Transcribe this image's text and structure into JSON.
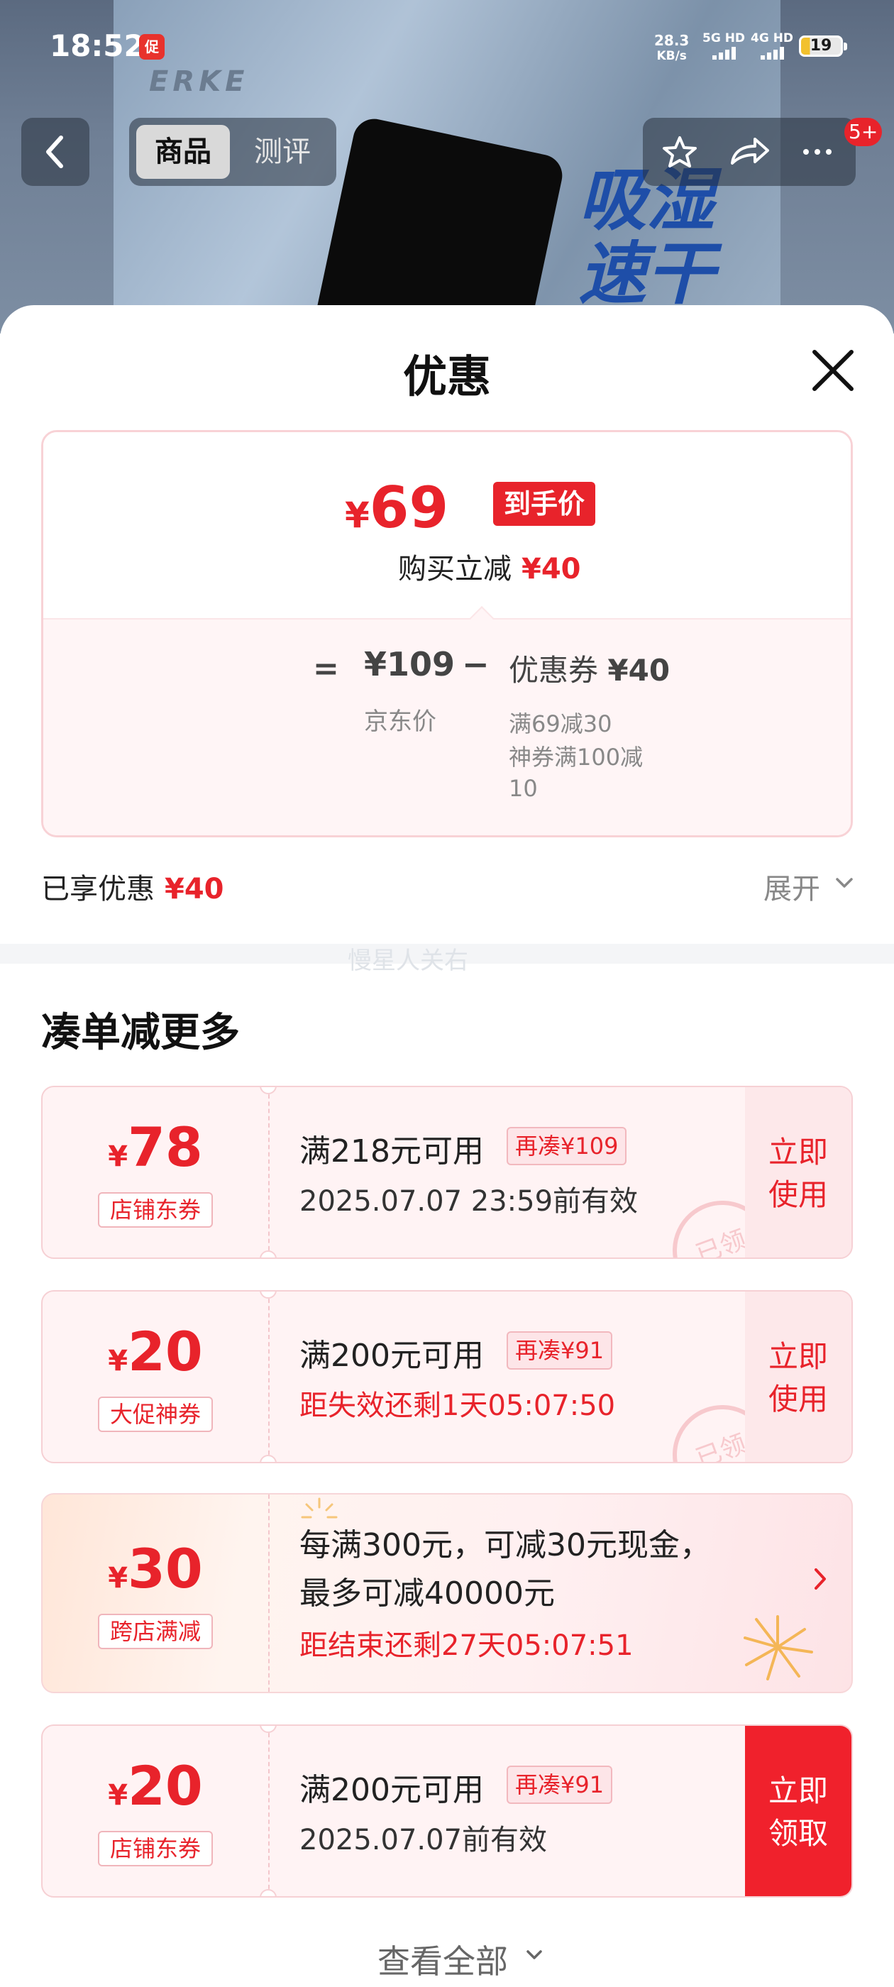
{
  "status_bar": {
    "time": "18:52",
    "network_speed_value": "28.3",
    "network_speed_unit": "KB/s",
    "signal_1": "5G HD",
    "signal_2": "4G HD",
    "battery": "19",
    "app_icon_label": "促"
  },
  "background": {
    "brand": "ERKE",
    "slogan_line1": "吸湿",
    "slogan_line2": "速干"
  },
  "nav": {
    "tabs": [
      "商品",
      "测评"
    ],
    "active_tab": "商品",
    "notification_badge": "5+"
  },
  "sheet": {
    "title": "优惠",
    "final_price_currency": "¥",
    "final_price_value": "69",
    "final_price_tag": "到手价",
    "instant_reduce_label": "购买立减",
    "instant_reduce_amount": "¥40",
    "equals": "=",
    "jd_price": "¥109",
    "jd_label": "京东价",
    "minus": "−",
    "coupon_label": "优惠券",
    "coupon_amount": "¥40",
    "coupon_detail_1": "满69减30",
    "coupon_detail_2": "神券满100减10",
    "enjoyed_label": "已享优惠",
    "enjoyed_amount": "¥40",
    "expand_label": "展开",
    "watermark": "慢星人关右"
  },
  "more_section": {
    "title": "凑单减更多",
    "coupons": [
      {
        "currency": "¥",
        "amount": "78",
        "type": "店铺东券",
        "condition": "满218元可用",
        "chip": "再凑¥109",
        "validity": "2025.07.07 23:59前有效",
        "action_line1": "立即",
        "action_line2": "使用",
        "stamp": "已领"
      },
      {
        "currency": "¥",
        "amount": "20",
        "type": "大促神券",
        "condition": "满200元可用",
        "chip": "再凑¥91",
        "validity": "距失效还剩1天05:07:50",
        "action_line1": "立即",
        "action_line2": "使用",
        "stamp": "已领"
      },
      {
        "currency": "¥",
        "amount": "30",
        "type": "跨店满减",
        "line1": "每满300元，可减30元现金，",
        "line2": "最多可减40000元",
        "validity": "距结束还剩27天05:07:51"
      },
      {
        "currency": "¥",
        "amount": "20",
        "type": "店铺东券",
        "condition": "满200元可用",
        "chip": "再凑¥91",
        "validity": "2025.07.07前有效",
        "action_line1": "立即",
        "action_line2": "领取"
      }
    ],
    "see_all": "查看全部"
  },
  "colors": {
    "accent_red": "#e8232b",
    "light_pink": "#fff3f4"
  }
}
